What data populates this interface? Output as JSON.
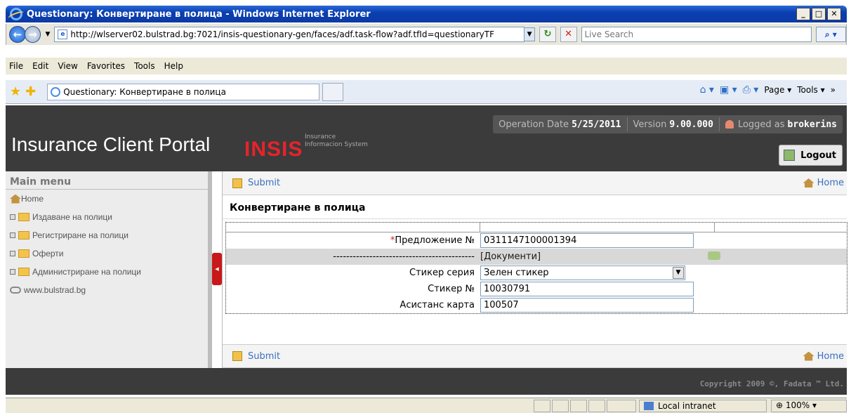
{
  "window": {
    "title": "Questionary: Конвертиране в полица - Windows Internet Explorer"
  },
  "addressbar": {
    "url": "http://wlserver02.bulstrad.bg:7021/insis-questionary-gen/faces/adf.task-flow?adf.tfId=questionaryTF",
    "search_placeholder": "Live Search"
  },
  "menubar": {
    "items": [
      "File",
      "Edit",
      "View",
      "Favorites",
      "Tools",
      "Help"
    ]
  },
  "tabs": {
    "active_tab": "Questionary: Конвертиране в полица",
    "page_label": "Page",
    "tools_label": "Tools"
  },
  "header": {
    "portal_title": "Insurance Client Portal",
    "brand": "INSIS",
    "brand_sub1": "Insurance",
    "brand_sub2": "Informacion System",
    "operation_date_label": "Operation Date",
    "operation_date": "5/25/2011",
    "version_label": "Version",
    "version": "9.00.000",
    "logged_label": "Logged as",
    "user": "brokerins",
    "logout_label": "Logout"
  },
  "sidebar": {
    "title": "Main menu",
    "items": [
      {
        "label": "Home",
        "icon": "home-icon"
      },
      {
        "label": "Издаване на полици",
        "icon": "folder-icon"
      },
      {
        "label": "Регистриране на полици",
        "icon": "folder-icon"
      },
      {
        "label": "Оферти",
        "icon": "folder-icon"
      },
      {
        "label": "Администриране на полици",
        "icon": "folder-icon"
      },
      {
        "label": "www.bulstrad.bg",
        "icon": "link-icon"
      }
    ]
  },
  "main": {
    "submit_label": "Submit",
    "home_label": "Home",
    "page_title": "Конвертиране в полица",
    "form": {
      "proposal_label": "Предложение №",
      "proposal_value": "0311147100001394",
      "separator": "-------------------------------------------",
      "documents_label": "[Документи]",
      "sticker_series_label": "Стикер серия",
      "sticker_series_value": "Зелен стикер",
      "sticker_no_label": "Стикер №",
      "sticker_no_value": "10030791",
      "assistance_label": "Асистанс карта",
      "assistance_value": "100507"
    }
  },
  "footer": {
    "copyright": "Copyright 2009 ©, Fadata ™ Ltd."
  },
  "statusbar": {
    "zone": "Local intranet",
    "zoom": "100%"
  }
}
